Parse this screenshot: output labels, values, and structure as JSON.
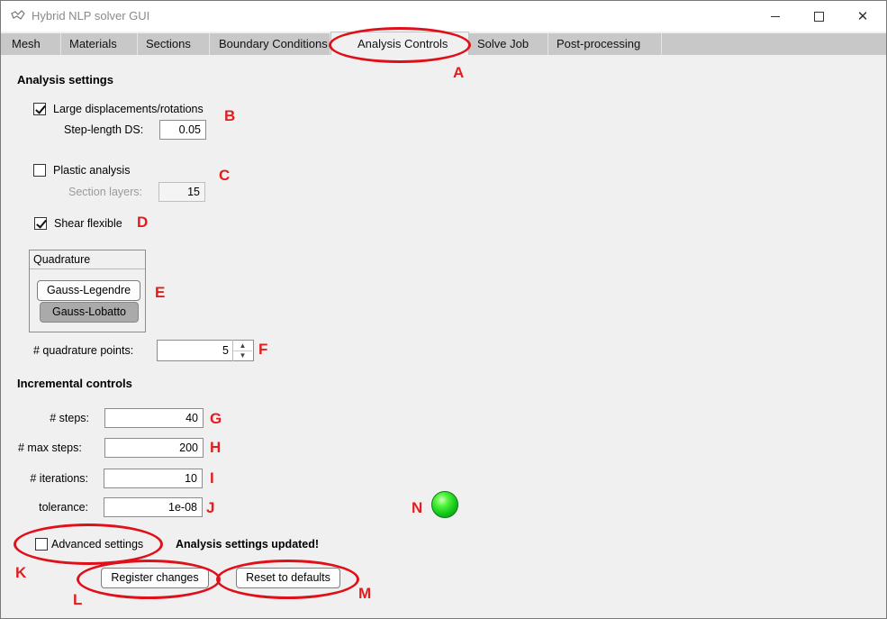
{
  "window": {
    "title": "Hybrid NLP solver GUI"
  },
  "tabs": [
    {
      "label": "Mesh"
    },
    {
      "label": "Materials"
    },
    {
      "label": "Sections"
    },
    {
      "label": "Boundary Conditions"
    },
    {
      "label": "Analysis Controls",
      "active": true
    },
    {
      "label": "Solve Job"
    },
    {
      "label": "Post-processing"
    }
  ],
  "analysis": {
    "heading": "Analysis settings",
    "large_displacements": {
      "label": "Large displacements/rotations",
      "checked": true
    },
    "step_length": {
      "label": "Step-length DS:",
      "value": "0.05"
    },
    "plastic": {
      "label": "Plastic analysis",
      "checked": false
    },
    "section_layers": {
      "label": "Section layers:",
      "value": "15"
    },
    "shear_flexible": {
      "label": "Shear flexible",
      "checked": true
    },
    "quadrature": {
      "title": "Quadrature",
      "options": [
        {
          "label": "Gauss-Legendre",
          "selected": false
        },
        {
          "label": "Gauss-Lobatto",
          "selected": true
        }
      ]
    },
    "quad_points": {
      "label": "# quadrature points:",
      "value": "5"
    }
  },
  "incremental": {
    "heading": "Incremental controls",
    "steps": {
      "label": "# steps:",
      "value": "40"
    },
    "max_steps": {
      "label": "#  max steps:",
      "value": "200"
    },
    "iterations": {
      "label": "# iterations:",
      "value": "10"
    },
    "tolerance": {
      "label": "tolerance:",
      "value": "1e-08"
    }
  },
  "advanced": {
    "label": "Advanced settings",
    "checked": false
  },
  "status": {
    "message": "Analysis settings updated!",
    "indicator_color": "#22dd22"
  },
  "buttons": {
    "register": "Register changes",
    "reset": "Reset to defaults"
  },
  "annotations": {
    "A": "A",
    "B": "B",
    "C": "C",
    "D": "D",
    "E": "E",
    "F": "F",
    "G": "G",
    "H": "H",
    "I": "I",
    "J": "J",
    "K": "K",
    "L": "L",
    "M": "M",
    "N": "N"
  },
  "colors": {
    "annotation": "#e31d1d",
    "tab_bar": "#c8c8c8",
    "panel": "#f0f0f0"
  }
}
